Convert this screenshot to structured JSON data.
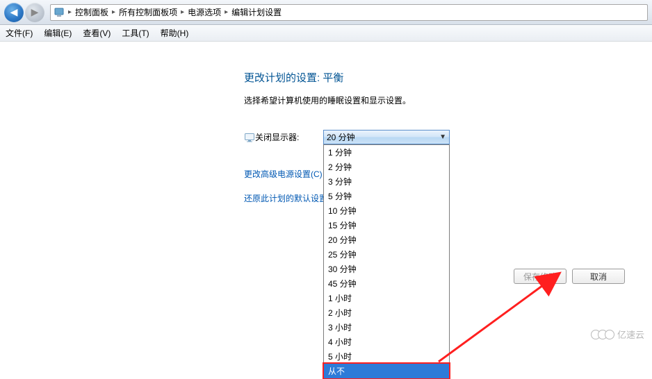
{
  "nav": {
    "crumbs": [
      "控制面板",
      "所有控制面板项",
      "电源选项",
      "编辑计划设置"
    ]
  },
  "menu": {
    "file": "文件(F)",
    "edit": "编辑(E)",
    "view": "查看(V)",
    "tools": "工具(T)",
    "help": "帮助(H)"
  },
  "page": {
    "title": "更改计划的设置: 平衡",
    "subtitle": "选择希望计算机使用的睡眠设置和显示设置。",
    "display_off_label": "关闭显示器:",
    "combo_selected": "20 分钟",
    "link_advanced": "更改高级电源设置(C)",
    "link_restore": "还原此计划的默认设置(R)"
  },
  "dropdown": {
    "items": [
      "1 分钟",
      "2 分钟",
      "3 分钟",
      "5 分钟",
      "10 分钟",
      "15 分钟",
      "20 分钟",
      "25 分钟",
      "30 分钟",
      "45 分钟",
      "1 小时",
      "2 小时",
      "3 小时",
      "4 小时",
      "5 小时",
      "从不"
    ],
    "highlight_index": 15
  },
  "buttons": {
    "save": "保存修改",
    "cancel": "取消"
  },
  "watermark": "亿速云"
}
